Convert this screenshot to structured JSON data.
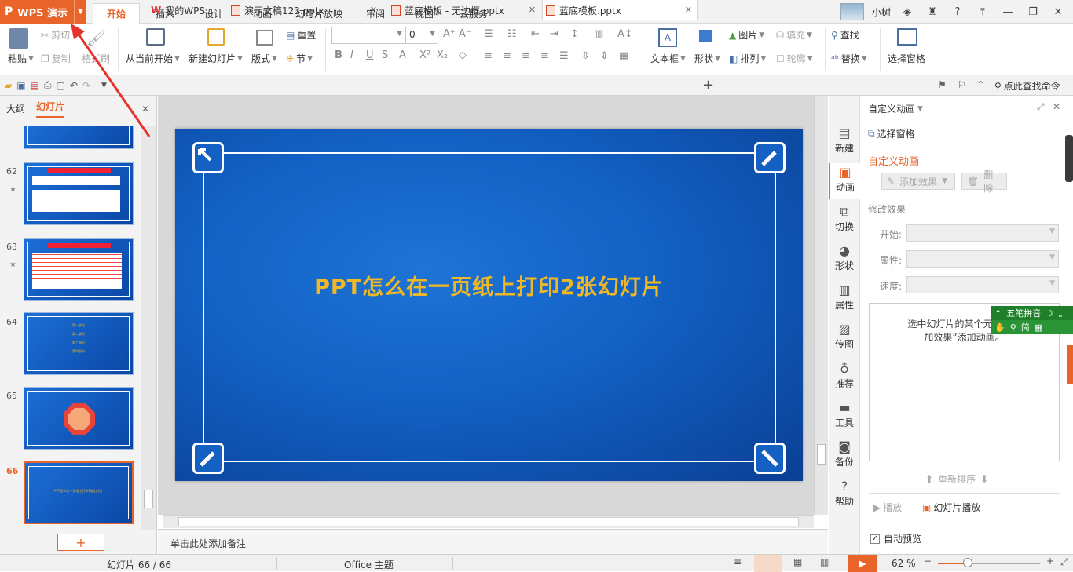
{
  "app": {
    "button_label": "WPS 演示"
  },
  "menu_tabs": [
    "开始",
    "插入",
    "设计",
    "动画",
    "幻灯片放映",
    "审阅",
    "视图",
    "云服务"
  ],
  "user": {
    "name": "小树"
  },
  "ribbon": {
    "paste": "粘贴",
    "cut": "剪切",
    "copy": "复制",
    "format_painter": "格式刷",
    "from_current": "从当前开始",
    "new_slide": "新建幻灯片",
    "layout": "版式",
    "reset": "重置",
    "section": "节",
    "font_size": "0",
    "text_box": "文本框",
    "shape": "形状",
    "picture": "图片",
    "fill": "填充",
    "arrange": "排列",
    "outline": "轮廓",
    "find": "查找",
    "replace": "替换",
    "select_pane": "选择窗格"
  },
  "doc_tabs": [
    "我的WPS",
    "演示文稿123.pptx",
    "蓝底模板 - 无边框.pptx",
    "蓝底模板.pptx"
  ],
  "search_cmd": "点此查找命令",
  "left_panel": {
    "tab_outline": "大纲",
    "tab_slides": "幻灯片",
    "thumb_numbers": [
      "62",
      "63",
      "64",
      "65",
      "66"
    ],
    "thumb64_lines": [
      "第一部分",
      "第二部分",
      "第三部分",
      "第四部分"
    ],
    "thumb66_text": "PPT怎么在一页纸上打印2张幻灯片",
    "add_slide": "+"
  },
  "slide": {
    "title": "PPT怎么在一页纸上打印2张幻灯片"
  },
  "notes_placeholder": "单击此处添加备注",
  "side_tools": [
    "新建",
    "动画",
    "切换",
    "形状",
    "属性",
    "传图",
    "推荐",
    "工具",
    "备份",
    "帮助"
  ],
  "anim_panel": {
    "header": "自定义动画",
    "select_pane": "选择窗格",
    "section_title": "自定义动画",
    "add_effect": "添加效果",
    "delete": "删除",
    "modify": "修改效果",
    "start_label": "开始:",
    "property_label": "属性:",
    "speed_label": "速度:",
    "hint_line1": "选中幻灯片的某个元素，然",
    "hint_line2": "加效果”添加动画。",
    "reorder": "重新排序",
    "play": "播放",
    "slideshow": "幻灯片播放",
    "autopreview": "自动预览"
  },
  "ime": {
    "label": "五笔拼音",
    "mode": "简"
  },
  "status": {
    "slide_count": "幻灯片 66 / 66",
    "theme": "Office 主题",
    "zoom": "62 %"
  },
  "colors": {
    "accent": "#e9642a",
    "slide_bg": "#1260c3",
    "title_color": "#f0b824"
  }
}
